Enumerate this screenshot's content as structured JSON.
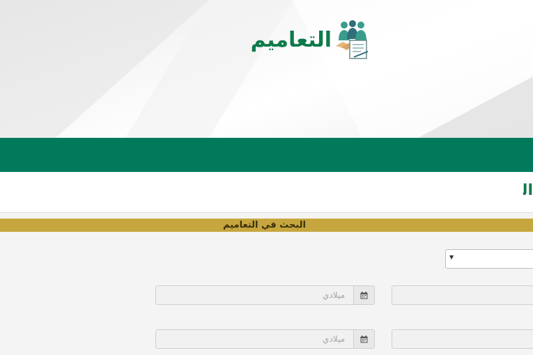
{
  "header": {
    "logo_text": "التعاميم",
    "logo_icon": "team-handshake-document-icon"
  },
  "page": {
    "title": "التعاميم"
  },
  "search": {
    "bar_title": "البحث في التعاميم",
    "date_from_placeholder": "ميلادي",
    "date_to_placeholder": "ميلادي",
    "calendar_icon": "calendar-icon",
    "select_arrow_icon": "caret-down-icon"
  },
  "colors": {
    "brand_green": "#007a5a",
    "logo_green": "#0d7a4a",
    "gold_bar": "#c6a63e"
  }
}
